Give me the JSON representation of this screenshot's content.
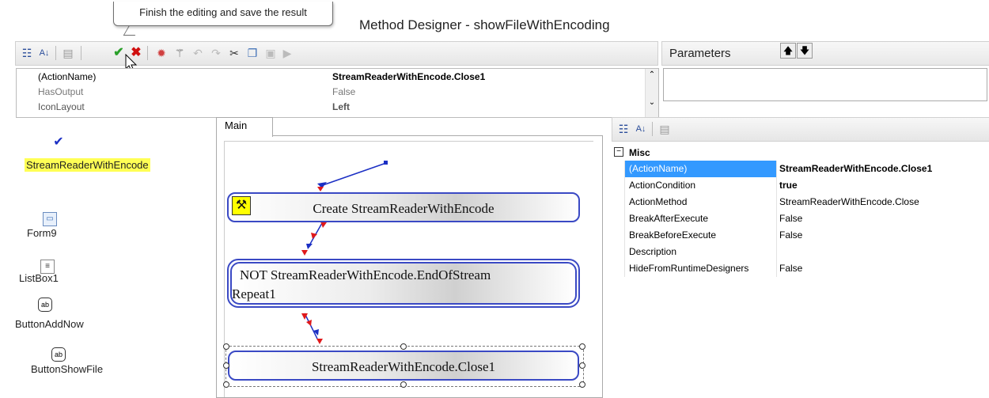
{
  "window": {
    "title": "Method Designer - showFileWithEncoding"
  },
  "tooltip": {
    "text": "Finish the editing and save the result"
  },
  "toolbar": {
    "icons": [
      "categorized-icon",
      "alphabetical-icon",
      "property-pages-icon",
      "finish-check-icon",
      "cancel-x-icon",
      "action-sun-icon",
      "magic-wand-icon",
      "undo-icon",
      "redo-icon",
      "cut-icon",
      "copy-icon",
      "paste-icon",
      "run-icon"
    ]
  },
  "parameters": {
    "label": "Parameters",
    "move_up": "🡅",
    "move_down": "🡇"
  },
  "top_properties": [
    {
      "name": "(ActionName)",
      "value": "StreamReaderWithEncode.Close1"
    },
    {
      "name": "HasOutput",
      "value": "False"
    },
    {
      "name": "IconLayout",
      "value": "Left"
    }
  ],
  "components": [
    {
      "label": "StreamReaderWithEncode"
    },
    {
      "label": "Form9"
    },
    {
      "label": "ListBox1"
    },
    {
      "label": "ButtonAddNow"
    },
    {
      "label": "ButtonShowFile"
    }
  ],
  "designer": {
    "tab": "Main",
    "nodes": [
      {
        "text": "Create StreamReaderWithEncode"
      },
      {
        "text": "NOT StreamReaderWithEncode.EndOfStream",
        "text2": "Repeat1"
      },
      {
        "text": "StreamReaderWithEncode.Close1"
      }
    ]
  },
  "property_grid": {
    "category": "Misc",
    "rows": [
      {
        "name": "(ActionName)",
        "value": "StreamReaderWithEncode.Close1"
      },
      {
        "name": "ActionCondition",
        "value": "true"
      },
      {
        "name": "ActionMethod",
        "value": "StreamReaderWithEncode.Close"
      },
      {
        "name": "BreakAfterExecute",
        "value": "False"
      },
      {
        "name": "BreakBeforeExecute",
        "value": "False"
      },
      {
        "name": "Description",
        "value": ""
      },
      {
        "name": "HideFromRuntimeDesigners",
        "value": "False"
      }
    ]
  },
  "colors": {
    "highlight": "#ffff55",
    "selection": "#3399ff",
    "node_border": "#3a49c4",
    "arrow_red": "#e0191b",
    "arrow_blue": "#1b2fc4"
  }
}
